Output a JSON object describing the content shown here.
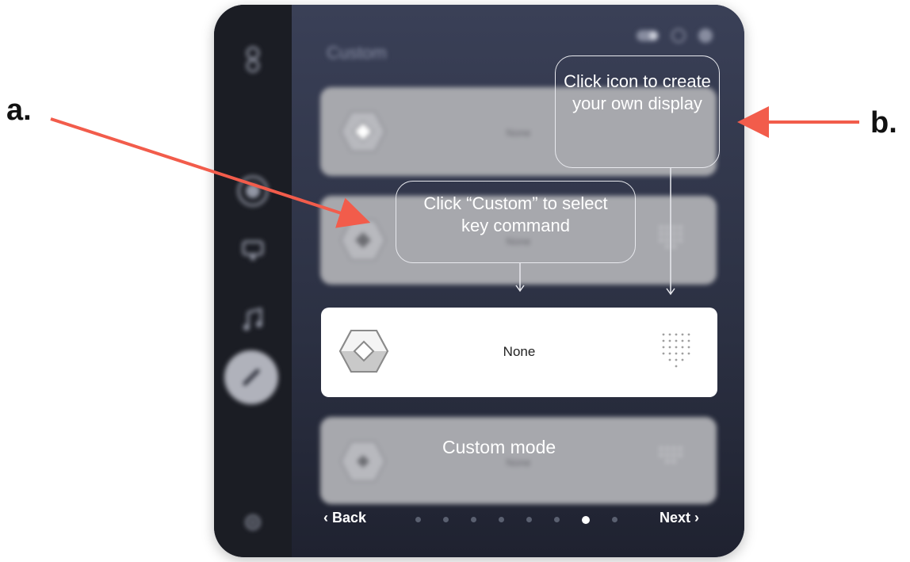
{
  "labels": {
    "a": "a.",
    "b": "b."
  },
  "header": {
    "title": "Custom"
  },
  "cards": [
    {
      "label": "None"
    },
    {
      "label": "None"
    },
    {
      "label": "None"
    },
    {
      "label": "None"
    }
  ],
  "overlay": {
    "bubble_b": "Click icon to create your own display",
    "bubble_a": "Click “Custom” to select key command",
    "mode_caption": "Custom mode"
  },
  "footer": {
    "back_label": "Back",
    "next_label": "Next",
    "page_count": 8,
    "active_page": 7
  },
  "colors": {
    "arrow": "#f25c4b",
    "active_card": "#ffffff",
    "frame": "#313749"
  }
}
